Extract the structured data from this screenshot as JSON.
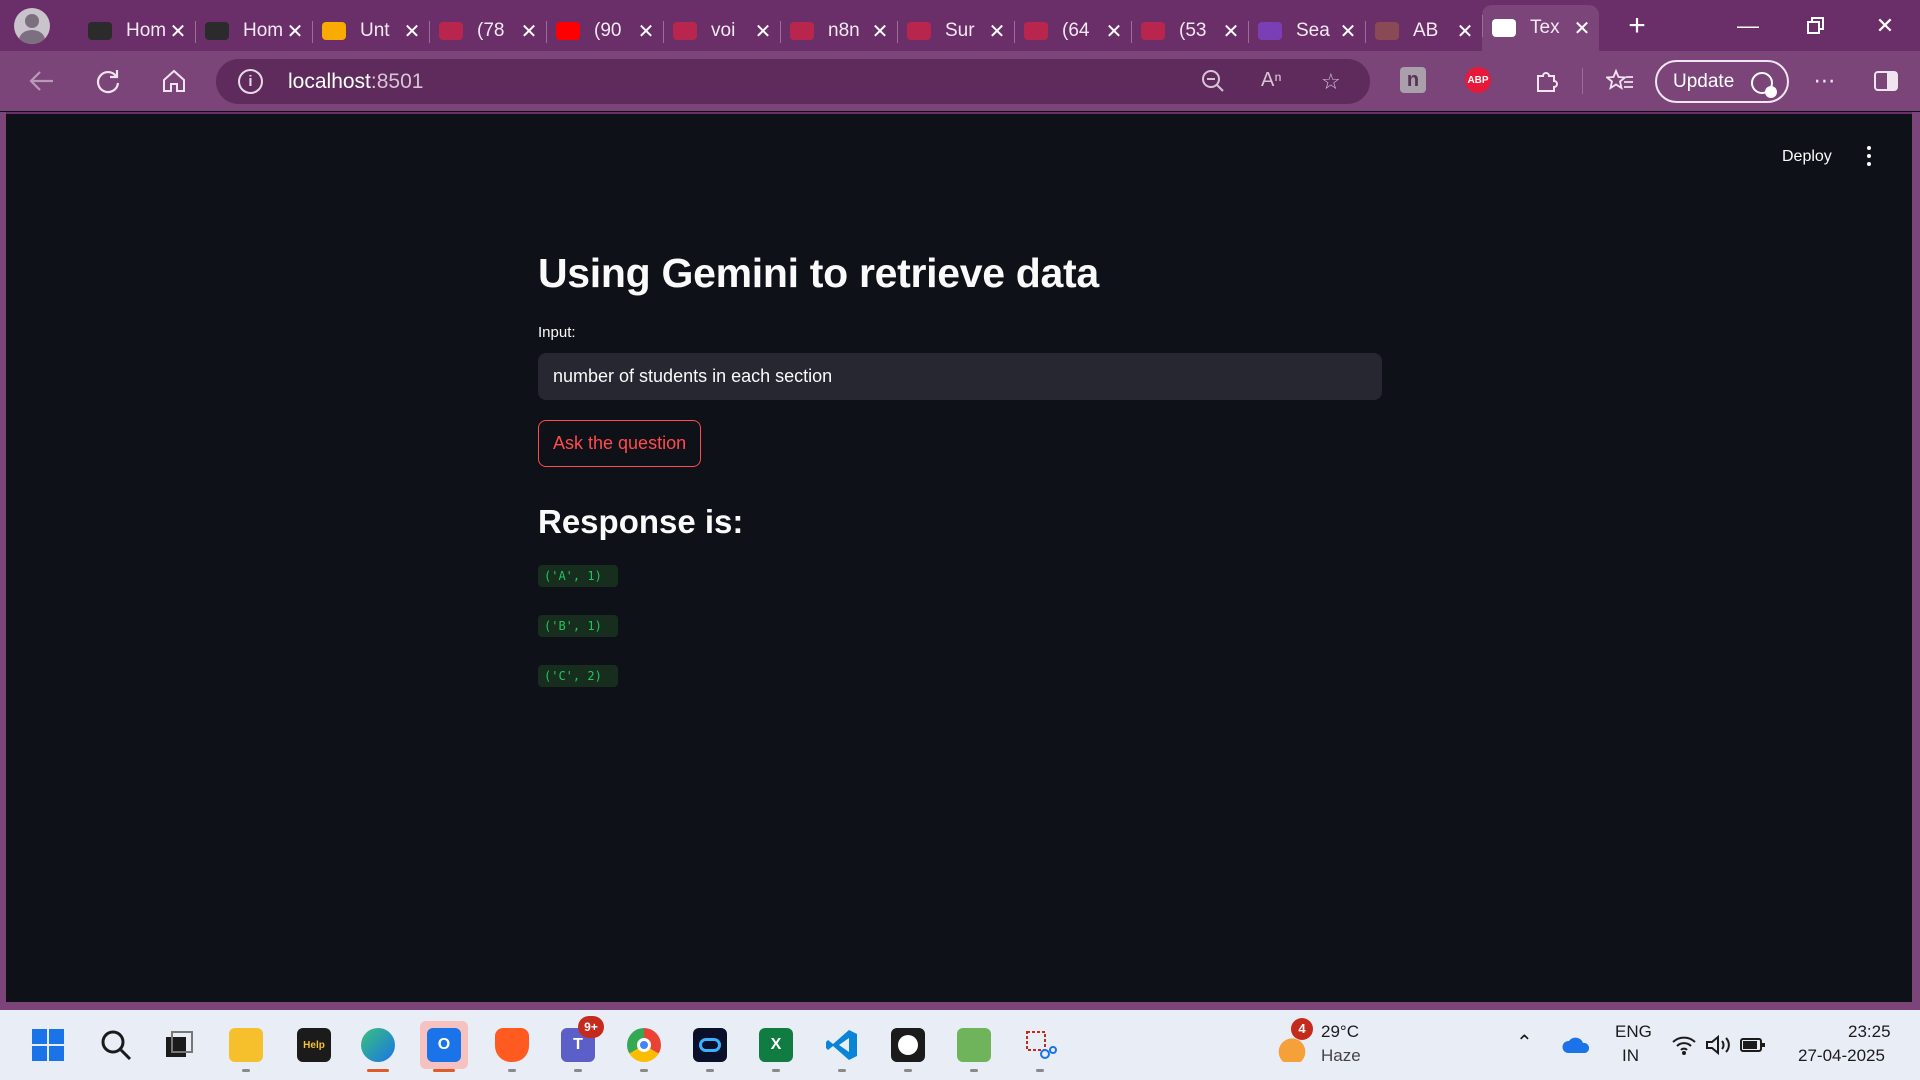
{
  "browser": {
    "tabs": [
      {
        "title": "Hom",
        "favicon": "dark-stripe-icon",
        "color": "#2b2b2b"
      },
      {
        "title": "Hom",
        "favicon": "dark-stripe-icon",
        "color": "#2b2b2b"
      },
      {
        "title": "Unt",
        "favicon": "colab-icon",
        "color": "#f9ab00"
      },
      {
        "title": "(78",
        "favicon": "youtube-icon",
        "color": "#b8264d"
      },
      {
        "title": "(90",
        "favicon": "youtube-icon",
        "color": "#ff0000"
      },
      {
        "title": "voi",
        "favicon": "youtube-icon",
        "color": "#b8264d"
      },
      {
        "title": "n8n",
        "favicon": "youtube-icon",
        "color": "#b8264d"
      },
      {
        "title": "Sur",
        "favicon": "youtube-icon",
        "color": "#b8264d"
      },
      {
        "title": "(64",
        "favicon": "youtube-icon",
        "color": "#b8264d"
      },
      {
        "title": "(53",
        "favicon": "youtube-icon",
        "color": "#b8264d"
      },
      {
        "title": "Sea",
        "favicon": "search-shield-icon",
        "color": "#7b3fb5"
      },
      {
        "title": "AB",
        "favicon": "pdf-icon",
        "color": "#8a4a55"
      },
      {
        "title": "Tex",
        "favicon": "streamlit-crown-icon",
        "color": "#ffffff"
      }
    ],
    "url_host": "localhost",
    "url_port": ":8501",
    "update_label": "Update",
    "extensions": {
      "abp_label": "ABP",
      "n_label": "n"
    }
  },
  "app": {
    "deploy_label": "Deploy",
    "title": "Using Gemini to retrieve data",
    "input_label": "Input:",
    "input_value": "number of students in each section",
    "button_label": "Ask the question",
    "response_heading": "Response is:",
    "responses": [
      "('A', 1)",
      "('B', 1)",
      "('C', 2)"
    ]
  },
  "taskbar": {
    "weather_temp": "29°C",
    "weather_desc": "Haze",
    "weather_badge": "4",
    "teams_badge": "9+",
    "lang_top": "ENG",
    "lang_bottom": "IN",
    "time": "23:25",
    "date": "27-04-2025",
    "excel_glyph": "X",
    "help_glyph": "Help"
  },
  "colors": {
    "accent": "#ff4b4b",
    "browser_frame": "#7b4579",
    "app_bg": "#0e1117"
  }
}
